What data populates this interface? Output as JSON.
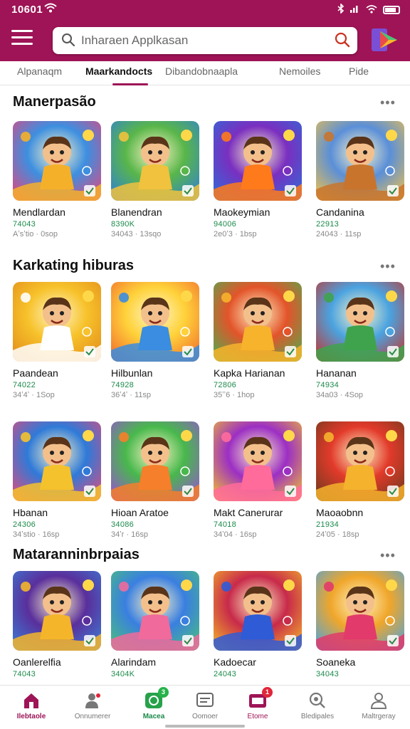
{
  "status": {
    "time": "10601"
  },
  "search": {
    "placeholder": "Inharaen Applkasan"
  },
  "tabs": [
    {
      "label": "Alpanaqm"
    },
    {
      "label": "Maarkandocts"
    },
    {
      "label": "Dibandobnaapla"
    },
    {
      "label": "Nemoiles"
    },
    {
      "label": "Pide"
    }
  ],
  "sections": [
    {
      "title": "Manerpasão",
      "cards": [
        {
          "name": "Mendlardan",
          "count": "74043",
          "meta": "Aʼsʼtio · 0sop",
          "palette": [
            "#3d8fe0",
            "#f5b02a",
            "#e9447a"
          ]
        },
        {
          "name": "Blanendran",
          "count": "8390K",
          "meta": "34043 · 13sqo",
          "palette": [
            "#59b64a",
            "#f0c23d",
            "#2f7fd6"
          ]
        },
        {
          "name": "Maokeymian",
          "count": "94006",
          "meta": "2e0ʼ3 · 1bsp",
          "palette": [
            "#7a2fc0",
            "#ff7a1a",
            "#2c6dd8"
          ]
        },
        {
          "name": "Candanina",
          "count": "22913",
          "meta": "24043 · 11sp",
          "palette": [
            "#5a8fd8",
            "#c9742c",
            "#f2c24b"
          ]
        }
      ]
    },
    {
      "title": "Karkating hiburas",
      "cards": [
        {
          "name": "Paandean",
          "count": "74022",
          "meta": "34ʼ4ʼ · 1Sop",
          "palette": [
            "#f7c22b",
            "#ffffff",
            "#e28b1a"
          ]
        },
        {
          "name": "Hilbunlan",
          "count": "74928",
          "meta": "36ʼ4ʼ · 11sp",
          "palette": [
            "#ffd23a",
            "#3a8de0",
            "#f06a2b"
          ]
        },
        {
          "name": "Kapka Harianan",
          "count": "72806",
          "meta": "35ʼʼ6 · 1hop",
          "palette": [
            "#e3542a",
            "#f7b32b",
            "#4caf50"
          ]
        },
        {
          "name": "Hananan",
          "count": "74934",
          "meta": "34a03 · 4Sop",
          "palette": [
            "#4aa3e0",
            "#3fa34d",
            "#c4332b"
          ]
        }
      ]
    },
    {
      "title": "",
      "cards": [
        {
          "name": "Hbanan",
          "count": "24306",
          "meta": "34ʼstio · 16sp",
          "palette": [
            "#2f7ad8",
            "#f4c22d",
            "#e64a7a"
          ]
        },
        {
          "name": "Hioan Aratoe",
          "count": "34086",
          "meta": "34ʼr · 16sp",
          "palette": [
            "#48b84c",
            "#f57f2a",
            "#9b4fd6"
          ]
        },
        {
          "name": "Makt Canerurar",
          "count": "74018",
          "meta": "34ʼ04 · 16sp",
          "palette": [
            "#9c2fc4",
            "#ff6b9b",
            "#f5c22d"
          ]
        },
        {
          "name": "Maoaobnn",
          "count": "21934",
          "meta": "24ʼ05 · 18sp",
          "palette": [
            "#e23a2a",
            "#f5b22d",
            "#6b3a1e"
          ]
        }
      ]
    },
    {
      "title": "Mataranninbrpaias",
      "cards": [
        {
          "name": "Oanlerelfia",
          "count": "74043",
          "meta": "",
          "palette": [
            "#5a2f9c",
            "#f4b52a",
            "#3b7fd6"
          ]
        },
        {
          "name": "Alarindam",
          "count": "3404K",
          "meta": "",
          "palette": [
            "#3a7fe0",
            "#f06a9b",
            "#4ac27a"
          ]
        },
        {
          "name": "Kadoecar",
          "count": "24043",
          "meta": "",
          "palette": [
            "#c82a4a",
            "#2f5bd6",
            "#f5b82a"
          ]
        },
        {
          "name": "Soaneka",
          "count": "34043",
          "meta": "",
          "palette": [
            "#f0a62a",
            "#e23a6a",
            "#4aa3e0"
          ]
        }
      ]
    }
  ],
  "nav": [
    {
      "label": "Ilebtaole",
      "icon": "home-icon",
      "active": true
    },
    {
      "label": "Onnumerer",
      "icon": "user-icon"
    },
    {
      "label": "Macea",
      "icon": "chat-icon",
      "badge": "3"
    },
    {
      "label": "Oomoer",
      "icon": "monitor-icon"
    },
    {
      "label": "Etome",
      "icon": "mail-icon",
      "badge": "1"
    },
    {
      "label": "Bledipales",
      "icon": "discover-icon"
    },
    {
      "label": "Maltrgeray",
      "icon": "profile-icon"
    }
  ],
  "colors": {
    "brand": "#9e1456",
    "green": "#1b8a4a",
    "badge": "#e0263a"
  }
}
